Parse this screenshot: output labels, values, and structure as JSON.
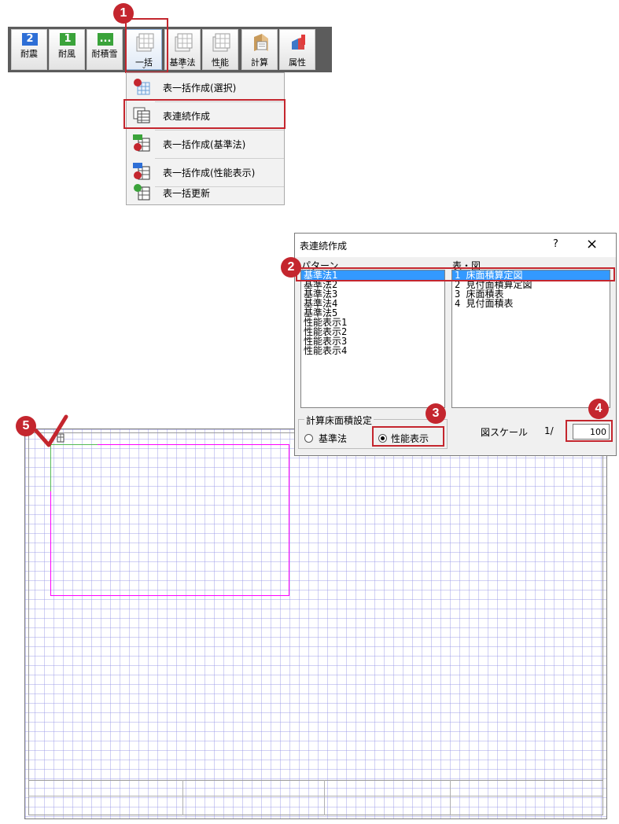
{
  "ribbon": {
    "buttons": [
      {
        "label": "耐震",
        "icon": "seismic-level-icon",
        "badge": "2",
        "color": "#2e6fd6"
      },
      {
        "label": "耐風",
        "icon": "wind-level-icon",
        "badge": "1",
        "color": "#3aa33a"
      },
      {
        "label": "耐積雪",
        "icon": "snow-level-icon",
        "badge": "...",
        "color": "#3aa33a"
      },
      {
        "label": "一括",
        "icon": "batch-table-icon",
        "chevron": "⌄"
      },
      {
        "label": "基準法",
        "icon": "building-standard-table-icon",
        "chevron": "⌄"
      },
      {
        "label": "性能",
        "icon": "performance-table-icon",
        "chevron": "⌄"
      },
      {
        "label": "計算",
        "icon": "calculation-icon"
      },
      {
        "label": "属性",
        "icon": "attribute-icon"
      }
    ]
  },
  "menu": {
    "items": [
      {
        "label": "表一括作成(選択)",
        "icon": "table-batch-select-icon"
      },
      {
        "label": "表連続作成",
        "icon": "table-continuous-icon"
      },
      {
        "label": "表一括作成(基準法)",
        "icon": "table-batch-standard-icon"
      },
      {
        "label": "表一括作成(性能表示)",
        "icon": "table-batch-performance-icon"
      },
      {
        "label": "表一括更新",
        "icon": "table-batch-update-icon"
      }
    ]
  },
  "dialog": {
    "title": "表連続作成",
    "help": "?",
    "close": "×",
    "pattern_label": "パターン",
    "patterns": [
      "基準法1",
      "基準法2",
      "基準法3",
      "基準法4",
      "基準法5",
      "性能表示1",
      "性能表示2",
      "性能表示3",
      "性能表示4"
    ],
    "selected_pattern": "基準法1",
    "table_label": "表・図",
    "tables": [
      "1 床面積算定図",
      "2 見付面積算定図",
      "3 床面積表",
      "4 見付面積表"
    ],
    "selected_table": "1 床面積算定図",
    "floor_area_group": "計算床面積設定",
    "option_standard": "基準法",
    "option_performance": "性能表示",
    "selected_option": "性能表示",
    "scale_label": "図スケール",
    "scale_prefix": "1/",
    "scale_value": "100"
  },
  "steps": [
    "1",
    "2",
    "3",
    "4",
    "5"
  ],
  "colors": {
    "accent": "#c4262e",
    "selection": "#3399ff",
    "ribbon_bg": "#5c5c5c",
    "frame_line": "#ff00ff"
  }
}
